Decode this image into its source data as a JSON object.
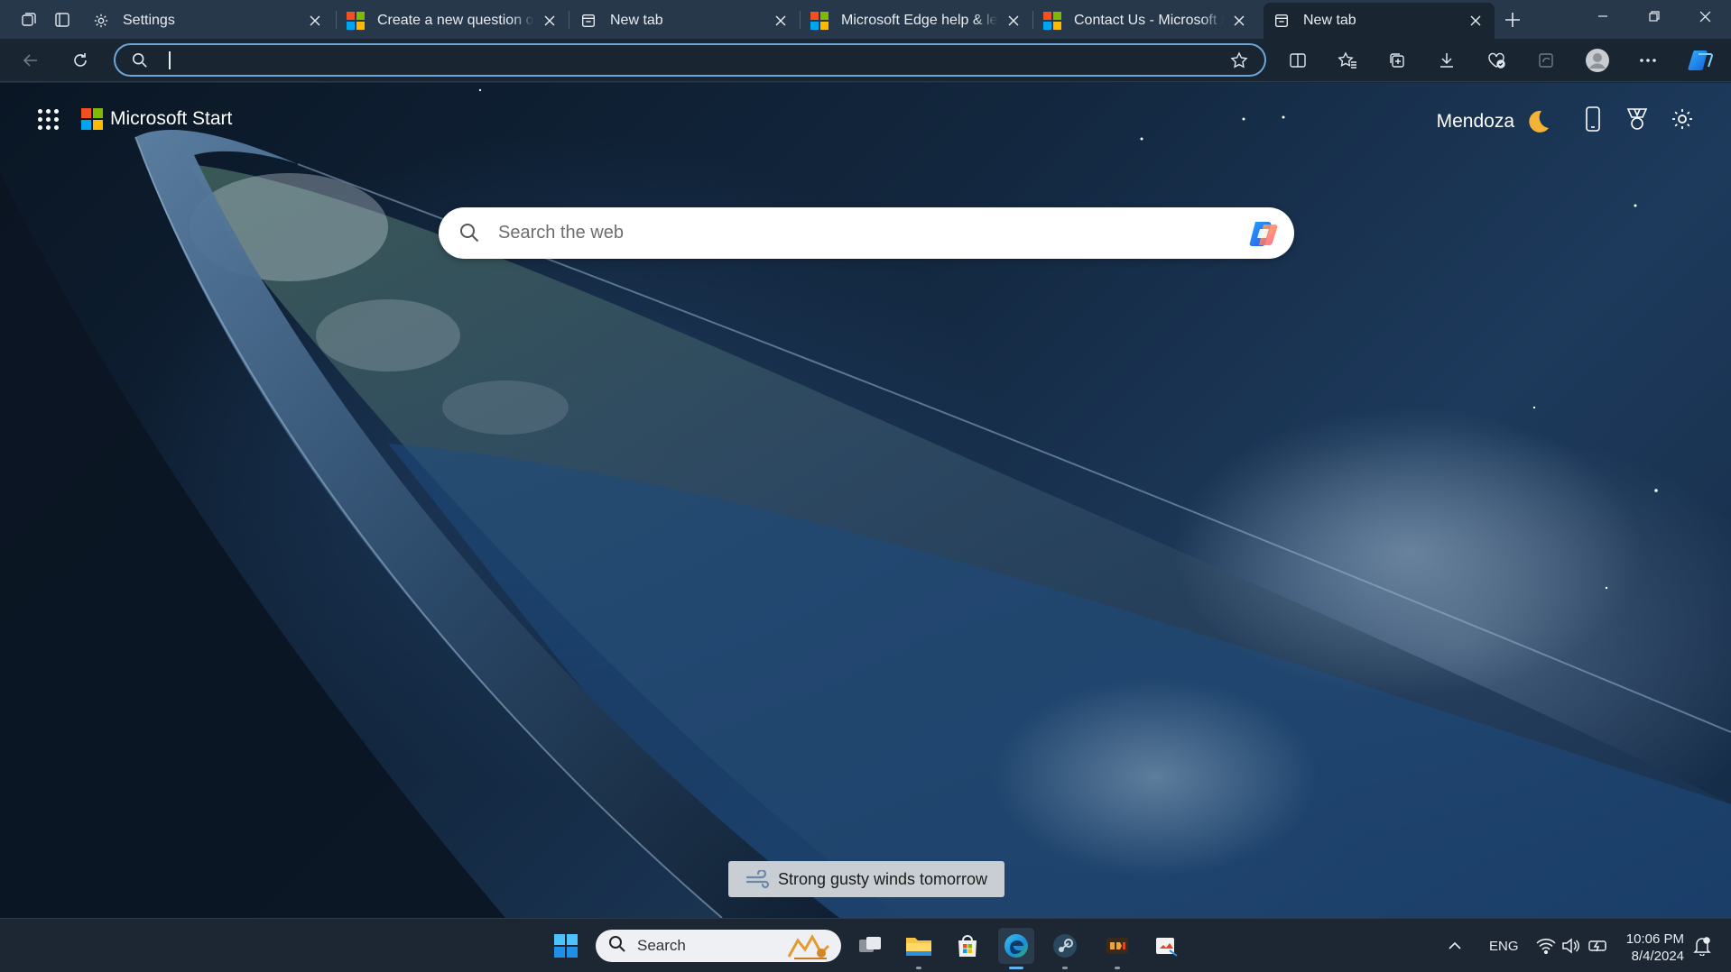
{
  "browser": {
    "tabs": [
      {
        "title": "Settings",
        "favicon": "gear-icon",
        "active": false
      },
      {
        "title": "Create a new question or start a discussion",
        "favicon": "microsoft-logo",
        "active": false
      },
      {
        "title": "New tab",
        "favicon": "newtab-icon",
        "active": false
      },
      {
        "title": "Microsoft Edge help & learning",
        "favicon": "microsoft-logo",
        "active": false
      },
      {
        "title": "Contact Us - Microsoft Support",
        "favicon": "microsoft-logo",
        "active": false
      },
      {
        "title": "New tab",
        "favicon": "newtab-icon",
        "active": true
      }
    ],
    "address": {
      "value": "",
      "placeholder": ""
    }
  },
  "start_page": {
    "brand": "Microsoft Start",
    "location": "Mendoza",
    "weather_icon": "moon-icon",
    "search_placeholder": "Search the web",
    "weather_alert": "Strong gusty winds tomorrow"
  },
  "taskbar": {
    "search_label": "Search",
    "language": "ENG",
    "time": "10:06 PM",
    "date": "8/4/2024"
  },
  "colors": {
    "tabstrip": "#26384a",
    "toolbar": "#1a2532",
    "omnibox_focus": "#6aa7d8",
    "taskbar": "#1c2733",
    "edge_active_indicator": "#5fb2f2"
  }
}
